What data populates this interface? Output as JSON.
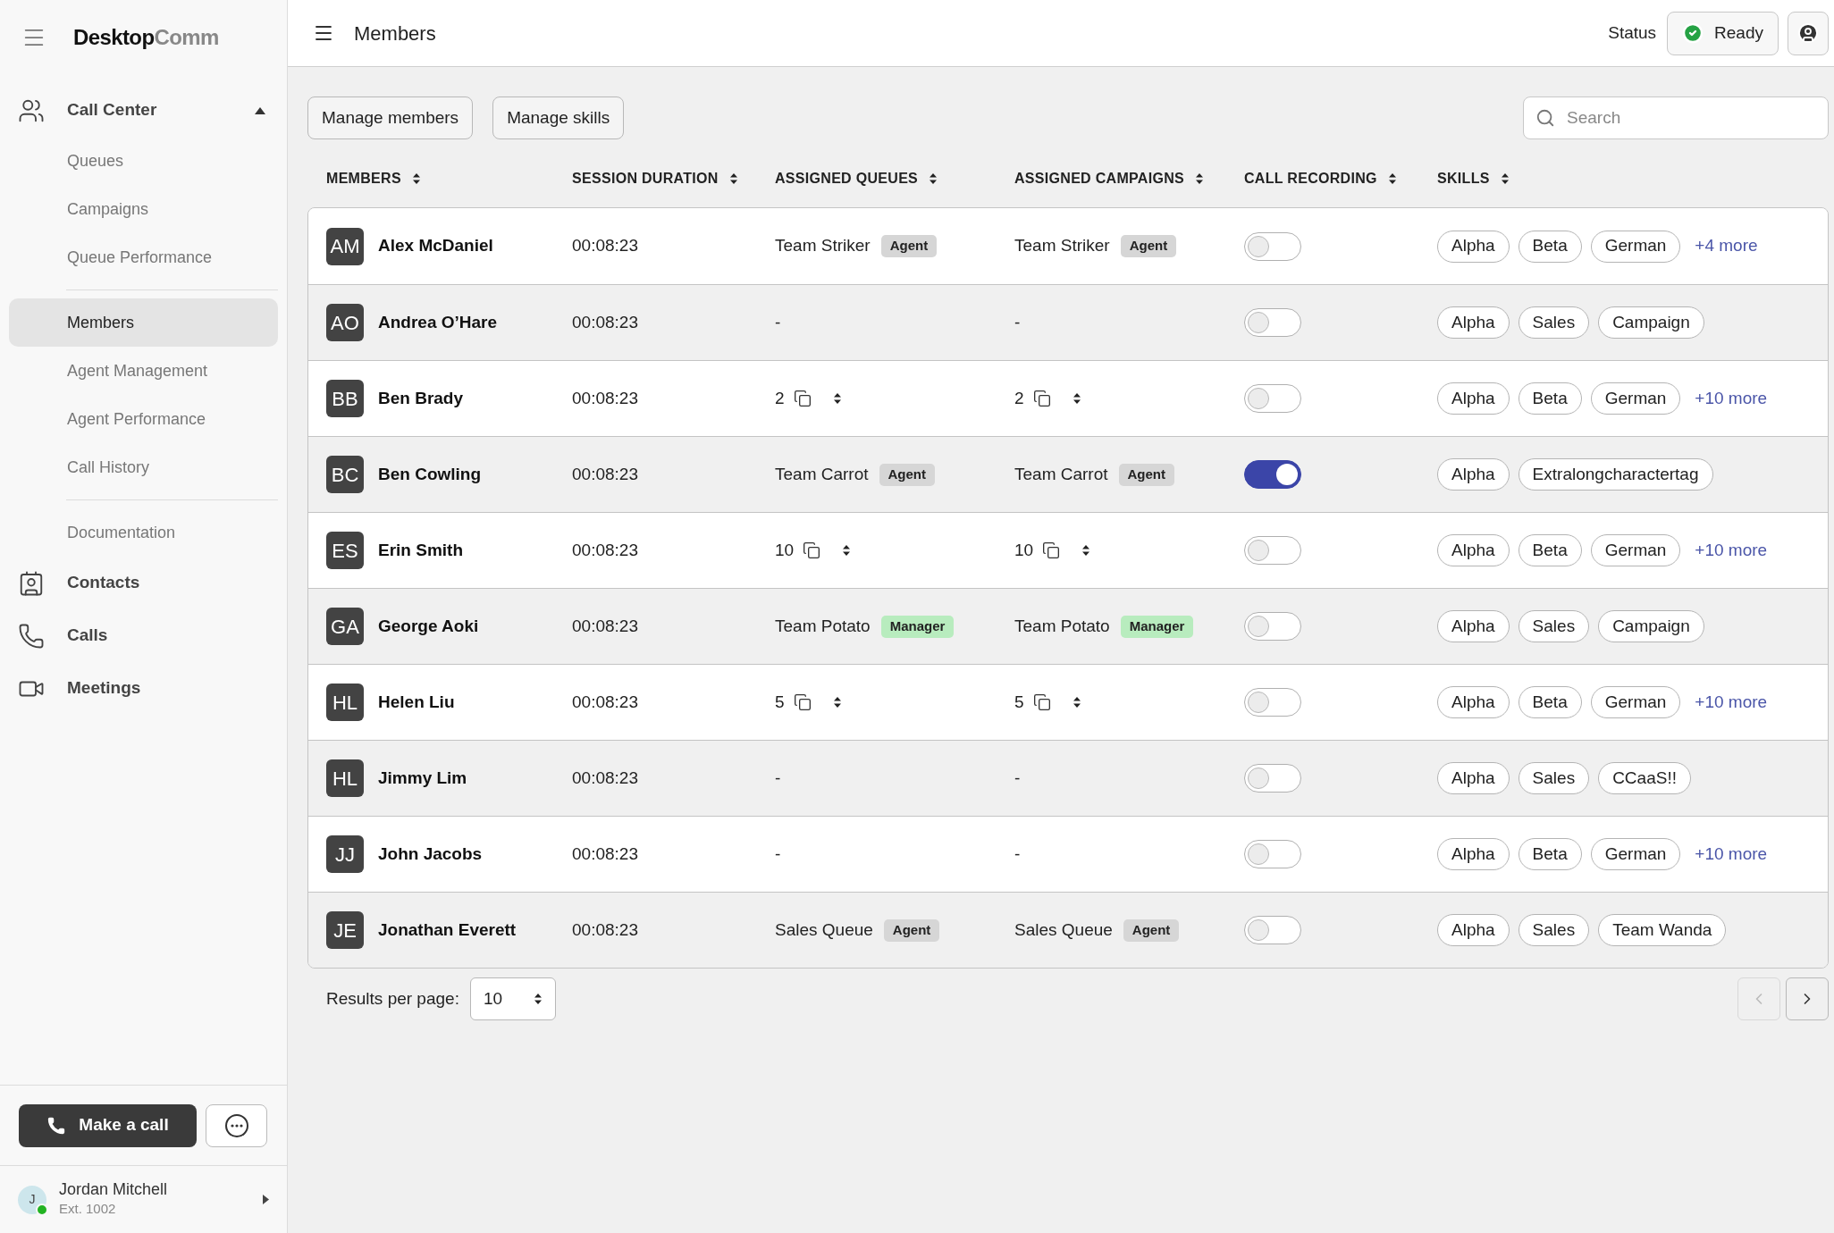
{
  "sidebar": {
    "logo": {
      "strong": "Desktop",
      "light": "Comm"
    },
    "nav": [
      {
        "kind": "group",
        "label": "Call Center",
        "expanded": true,
        "sections": [
          [
            {
              "label": "Queues",
              "selected": false
            },
            {
              "label": "Campaigns",
              "selected": false
            },
            {
              "label": "Queue Performance",
              "selected": false
            }
          ],
          [
            {
              "label": "Members",
              "selected": true
            },
            {
              "label": "Agent Management",
              "selected": false
            },
            {
              "label": "Agent Performance",
              "selected": false
            },
            {
              "label": "Call History",
              "selected": false
            }
          ],
          [
            {
              "label": "Documentation",
              "selected": false
            }
          ]
        ]
      },
      {
        "kind": "contacts",
        "label": "Contacts"
      },
      {
        "kind": "calls",
        "label": "Calls"
      },
      {
        "kind": "meetings",
        "label": "Meetings"
      }
    ],
    "call_button": "Make a call",
    "user": {
      "name": "Jordan Mitchell",
      "ext": "Ext. 1002",
      "initial": "J",
      "online": true
    }
  },
  "header": {
    "title": "Members",
    "status_label": "Status",
    "status": "Ready"
  },
  "toolbar": {
    "buttons": [
      "Manage members",
      "Manage skills"
    ],
    "search": {
      "placeholder": "Search"
    }
  },
  "table": {
    "columns": [
      "MEMBERS",
      "SESSION DURATION",
      "ASSIGNED QUEUES",
      "ASSIGNED CAMPAIGNS",
      "CALL RECORDING",
      "SKILLS"
    ],
    "rows": [
      {
        "initials": "AM",
        "name": "Alex McDaniel",
        "duration": "00:08:23",
        "queues": {
          "kind": "team",
          "name": "Team Striker",
          "role": "Agent",
          "color": "#d6d6d6"
        },
        "campaigns": {
          "kind": "team",
          "name": "Team Striker",
          "role": "Agent",
          "color": "#d6d6d6"
        },
        "recording": false,
        "skills": [
          "Alpha",
          "Beta",
          "German"
        ],
        "more": "+4 more"
      },
      {
        "initials": "AO",
        "name": "Andrea O’Hare",
        "duration": "00:08:23",
        "queues": {
          "kind": "none",
          "text": "-"
        },
        "campaigns": {
          "kind": "none",
          "text": "-"
        },
        "recording": false,
        "skills": [
          "Alpha",
          "Sales",
          "Campaign"
        ]
      },
      {
        "initials": "BB",
        "name": "Ben Brady",
        "duration": "00:08:23",
        "queues": {
          "kind": "count",
          "count": "2"
        },
        "campaigns": {
          "kind": "count",
          "count": "2"
        },
        "recording": false,
        "skills": [
          "Alpha",
          "Beta",
          "German"
        ],
        "more": "+10 more"
      },
      {
        "initials": "BC",
        "name": "Ben Cowling",
        "duration": "00:08:23",
        "queues": {
          "kind": "team",
          "name": "Team Carrot",
          "role": "Agent",
          "color": "#d6d6d6"
        },
        "campaigns": {
          "kind": "team",
          "name": "Team Carrot",
          "role": "Agent",
          "color": "#d6d6d6"
        },
        "recording": true,
        "skills": [
          "Alpha",
          "Extralongcharactertag"
        ]
      },
      {
        "initials": "ES",
        "name": "Erin Smith",
        "duration": "00:08:23",
        "queues": {
          "kind": "count",
          "count": "10"
        },
        "campaigns": {
          "kind": "count",
          "count": "10"
        },
        "recording": false,
        "skills": [
          "Alpha",
          "Beta",
          "German"
        ],
        "more": "+10 more"
      },
      {
        "initials": "GA",
        "name": "George Aoki",
        "duration": "00:08:23",
        "queues": {
          "kind": "team",
          "name": "Team Potato",
          "role": "Manager",
          "color": "#b8ecbe"
        },
        "campaigns": {
          "kind": "team",
          "name": "Team Potato",
          "role": "Manager",
          "color": "#b8ecbe"
        },
        "recording": false,
        "skills": [
          "Alpha",
          "Sales",
          "Campaign"
        ]
      },
      {
        "initials": "HL",
        "name": "Helen Liu",
        "duration": "00:08:23",
        "queues": {
          "kind": "count",
          "count": "5"
        },
        "campaigns": {
          "kind": "count",
          "count": "5"
        },
        "recording": false,
        "skills": [
          "Alpha",
          "Beta",
          "German"
        ],
        "more": "+10 more"
      },
      {
        "initials": "HL",
        "name": "Jimmy Lim",
        "duration": "00:08:23",
        "queues": {
          "kind": "none",
          "text": "-"
        },
        "campaigns": {
          "kind": "none",
          "text": "-"
        },
        "recording": false,
        "skills": [
          "Alpha",
          "Sales",
          "CCaaS!!"
        ]
      },
      {
        "initials": "JJ",
        "name": "John Jacobs",
        "duration": "00:08:23",
        "queues": {
          "kind": "none",
          "text": "-"
        },
        "campaigns": {
          "kind": "none",
          "text": "-"
        },
        "recording": false,
        "skills": [
          "Alpha",
          "Beta",
          "German"
        ],
        "more": "+10 more"
      },
      {
        "initials": "JE",
        "name": "Jonathan Everett",
        "duration": "00:08:23",
        "queues": {
          "kind": "team",
          "name": "Sales Queue",
          "role": "Agent",
          "color": "#d6d6d6"
        },
        "campaigns": {
          "kind": "team",
          "name": "Sales Queue",
          "role": "Agent",
          "color": "#d6d6d6"
        },
        "recording": false,
        "skills": [
          "Alpha",
          "Sales",
          "Team Wanda"
        ]
      }
    ]
  },
  "pagination": {
    "label": "Results per page:",
    "per_page": "10",
    "prev_disabled": true,
    "next_disabled": false
  }
}
